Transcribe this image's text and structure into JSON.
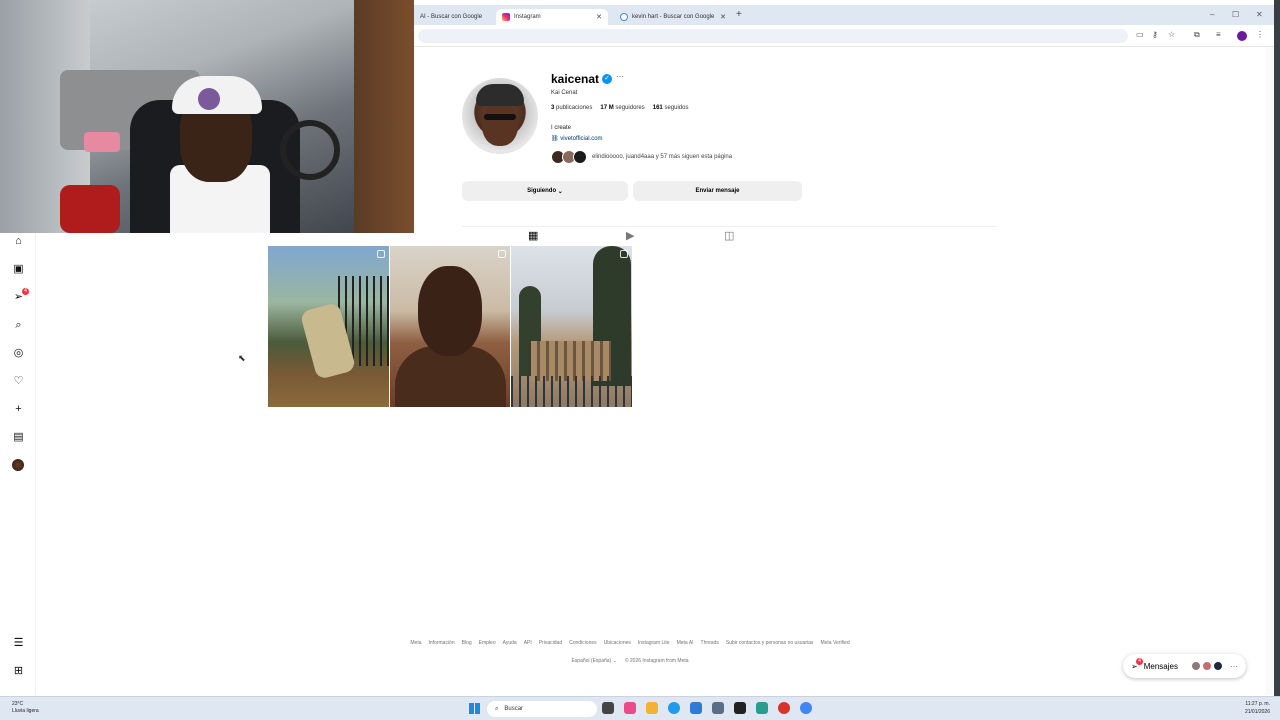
{
  "browser": {
    "tabs": [
      {
        "label": "AI - Buscar con Google",
        "active": false
      },
      {
        "label": "Instagram",
        "active": true
      },
      {
        "label": "kevin hart - Buscar con Google",
        "active": false
      }
    ],
    "new_tab_glyph": "+",
    "window_controls": [
      "–",
      "☐",
      "✕"
    ]
  },
  "sidebar": {
    "icons": [
      "home-icon",
      "reels-icon",
      "messages-icon",
      "search-icon",
      "explore-icon",
      "notifications-icon",
      "create-icon",
      "dashboard-icon",
      "profile-avatar",
      "menu-icon",
      "more-apps-icon"
    ],
    "messages_badge": "4"
  },
  "profile": {
    "username": "kaicenat",
    "full_name": "Kai Cenat",
    "posts_count": "3",
    "posts_label": "publicaciones",
    "followers_count": "17 M",
    "followers_label": "seguidores",
    "following_count": "161",
    "following_label": "seguidos",
    "bio": "I create",
    "link": "vivetofficial.com",
    "followed_by": "elindiooooo, juand4aaa y 57 más siguen esta página",
    "following_button": "Siguiendo",
    "message_button": "Enviar mensaje"
  },
  "footer": {
    "links": [
      "Meta",
      "Información",
      "Blog",
      "Empleo",
      "Ayuda",
      "API",
      "Privacidad",
      "Condiciones",
      "Ubicaciones",
      "Instagram Lite",
      "Meta AI",
      "Threads",
      "Subir contactos y personas no usuarias",
      "Meta Verified"
    ],
    "language": "Español (España)",
    "copyright": "© 2026 Instagram from Meta"
  },
  "messages_widget": {
    "label": "Mensajes",
    "badge": "4"
  },
  "taskbar": {
    "temperature": "23°C",
    "weather": "Lluvia ligera",
    "search_placeholder": "Buscar",
    "time": "11:27 p. m.",
    "date": "21/01/2026"
  },
  "colors": {
    "accent": "#0095f6",
    "badge": "#ff3040",
    "link": "#00376b"
  }
}
